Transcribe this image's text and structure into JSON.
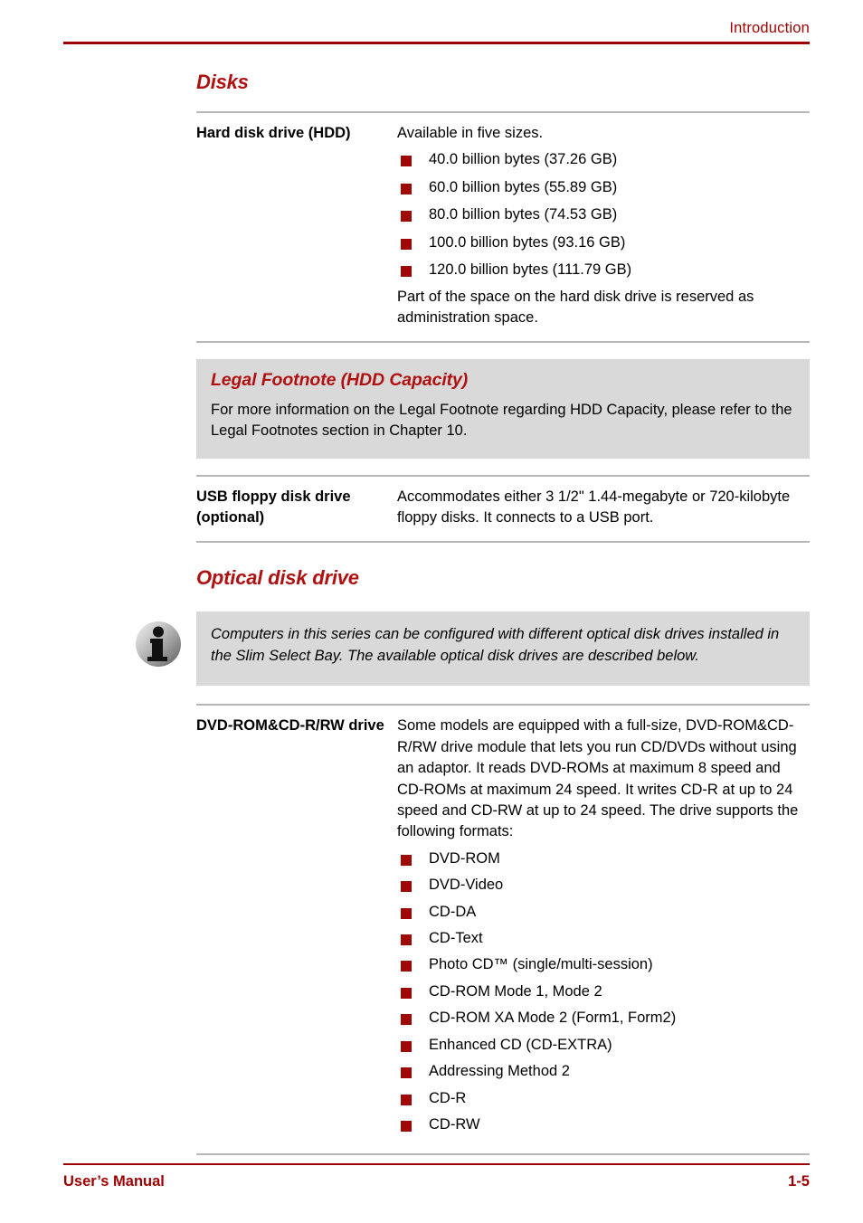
{
  "header": {
    "chapter_title": "Introduction"
  },
  "footer": {
    "left_label": "User’s Manual",
    "page_number": "1-5"
  },
  "colors": {
    "heading_red": "#B01010",
    "rule_red": "#9C0000",
    "bullet_red": "#A00808",
    "callout_gray": "#D9D9D9",
    "rule_gray": "#B6B6B6"
  },
  "sections": {
    "disks": {
      "heading": "Disks",
      "hdd": {
        "term": "Hard disk drive (HDD)",
        "intro": "Available in five sizes.",
        "sizes": [
          "40.0 billion bytes (37.26 GB)",
          "60.0 billion bytes (55.89 GB)",
          "80.0 billion bytes (74.53 GB)",
          "100.0 billion bytes (93.16 GB)",
          "120.0 billion bytes (111.79 GB)"
        ],
        "note": "Part of the space on the hard disk drive is reserved as administration space."
      },
      "legal_footnote": {
        "title": "Legal Footnote (HDD Capacity)",
        "body": "For more information on the Legal Footnote regarding HDD Capacity, please refer to the Legal Footnotes section in Chapter 10."
      },
      "usb_floppy": {
        "term": "USB floppy disk drive (optional)",
        "desc": "Accommodates either 3 1/2\" 1.44-megabyte or 720-kilobyte floppy disks. It connects to a USB port."
      }
    },
    "optical": {
      "heading": "Optical disk drive",
      "note": {
        "icon": "info-icon",
        "body": "Computers in this series can be configured with different optical disk drives installed in the Slim Select Bay. The available optical disk drives are described below."
      },
      "dvd_rom_cdrw": {
        "term": "DVD-ROM&CD-R/RW drive",
        "desc": "Some models are equipped with a full-size, DVD-ROM&CD-R/RW drive module that lets you run CD/DVDs without using an adaptor. It reads DVD-ROMs at maximum 8 speed and CD-ROMs at maximum 24 speed. It writes CD-R at up to 24 speed and CD-RW at up to 24 speed. The drive supports the following formats:",
        "formats": [
          "DVD-ROM",
          "DVD-Video",
          "CD-DA",
          "CD-Text",
          "Photo CD™ (single/multi-session)",
          "CD-ROM Mode 1, Mode 2",
          "CD-ROM XA Mode 2 (Form1, Form2)",
          "Enhanced CD (CD-EXTRA)",
          "Addressing Method 2",
          "CD-R",
          "CD-RW"
        ]
      }
    }
  }
}
